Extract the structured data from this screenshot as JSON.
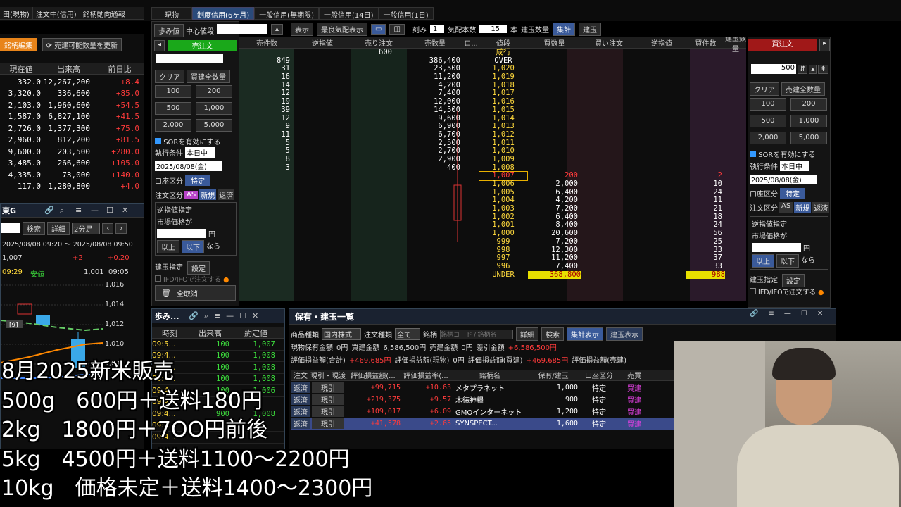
{
  "top_strip": {
    "tabs": [
      "現物",
      "制度信用(6ヶ月)",
      "一般信用(無期限)",
      "一般信用(14日)",
      "一般信用(1日)"
    ],
    "left_tabs": [
      "田(現物)",
      "注文中(信用)",
      "銘柄動向通報"
    ]
  },
  "left_list": {
    "edit_label": "銘柄編集",
    "update_label": "売建可能数量を更新",
    "headers": [
      "現在値",
      "出来高",
      "前日比"
    ],
    "rows": [
      [
        "332.0",
        "12,267,200",
        "+8.4"
      ],
      [
        "3,320.0",
        "336,600",
        "+85.0"
      ],
      [
        "2,103.0",
        "1,960,600",
        "+54.5"
      ],
      [
        "1,587.0",
        "6,827,100",
        "+41.5"
      ],
      [
        "2,726.0",
        "1,377,300",
        "+75.0"
      ],
      [
        "2,960.0",
        "812,200",
        "+81.5"
      ],
      [
        "9,600.0",
        "203,500",
        "+280.0"
      ],
      [
        "3,485.0",
        "266,600",
        "+105.0"
      ],
      [
        "4,335.0",
        "73,000",
        "+140.0"
      ],
      [
        "117.0",
        "1,280,800",
        "+4.0"
      ]
    ]
  },
  "chart_panel": {
    "title": "東G",
    "search_label": "検索",
    "detail_label": "詳細",
    "interval": "2分足",
    "range": "2025/08/08 09:20 ～ 2025/08/08 09:50",
    "price": "1,007",
    "change": "+2",
    "change2": "+0.20",
    "time": "09:29",
    "low_label": "安値",
    "low_value": "1,001",
    "low_time": "09:05",
    "axis": [
      "1,016",
      "1,014",
      "1,012",
      "1,010",
      "1,008"
    ],
    "marker": "[9]"
  },
  "order_left": {
    "ayumi": "歩み値",
    "center_label": "中心値段",
    "display_btn": "表示",
    "best_label": "最良気配表示",
    "sell_btn": "売注文",
    "clear": "クリア",
    "sell_all": "買建全数量",
    "qty": [
      "100",
      "200",
      "500",
      "1,000",
      "2,000",
      "5,000"
    ],
    "sor": "SORを有効にする",
    "exec_label": "執行条件",
    "exec_value": "本日中",
    "date": "2025/08/08(金)",
    "account_label": "口座区分",
    "account_value": "特定",
    "order_type_label": "注文区分",
    "as": "AS",
    "new": "新規",
    "close": "返済",
    "stop_title": "逆指値指定",
    "market_label": "市場価格が",
    "yen": "円",
    "above": "以上",
    "below": "以下",
    "nara": "なら",
    "position_label": "建玉指定",
    "setting": "設定",
    "ifd": "IFD/IFOで注文する",
    "cancel_all": "全取消"
  },
  "board": {
    "kizami_label": "刻み",
    "kizami": "1",
    "ita_label": "気配本数",
    "ita": "15",
    "hon": "本",
    "position_qty": "建玉数量",
    "shukei": "集計",
    "tategyoku": "建玉",
    "headers": [
      "売件数",
      "逆指値",
      "売り注文",
      "売数量",
      "ロ...",
      "値段",
      "買数量",
      "買い注文",
      "逆指値",
      "買件数",
      "建玉数量"
    ],
    "top_order": "600",
    "market_label": "成行",
    "sell_rows": [
      [
        "849",
        "386,400",
        "OVER"
      ],
      [
        "31",
        "23,500",
        "1,020"
      ],
      [
        "16",
        "11,200",
        "1,019"
      ],
      [
        "14",
        "4,200",
        "1,018"
      ],
      [
        "12",
        "7,400",
        "1,017"
      ],
      [
        "19",
        "12,000",
        "1,016"
      ],
      [
        "39",
        "14,500",
        "1,015"
      ],
      [
        "12",
        "9,600",
        "1,014"
      ],
      [
        "9",
        "6,900",
        "1,013"
      ],
      [
        "11",
        "6,700",
        "1,012"
      ],
      [
        "5",
        "2,500",
        "1,011"
      ],
      [
        "5",
        "2,700",
        "1,010"
      ],
      [
        "8",
        "2,900",
        "1,009"
      ],
      [
        "3",
        "400",
        "1,008"
      ]
    ],
    "buy_rows": [
      [
        "1,007",
        "200",
        "2"
      ],
      [
        "1,006",
        "2,000",
        "10"
      ],
      [
        "1,005",
        "6,400",
        "24"
      ],
      [
        "1,004",
        "4,200",
        "11"
      ],
      [
        "1,003",
        "7,200",
        "21"
      ],
      [
        "1,002",
        "6,400",
        "18"
      ],
      [
        "1,001",
        "8,400",
        "24"
      ],
      [
        "1,000",
        "20,600",
        "56"
      ],
      [
        "999",
        "7,200",
        "25"
      ],
      [
        "998",
        "12,300",
        "33"
      ],
      [
        "997",
        "11,200",
        "37"
      ],
      [
        "996",
        "7,400",
        "33"
      ]
    ],
    "under_label": "UNDER",
    "under_qty": "368,800",
    "under_count": "988"
  },
  "order_right": {
    "buy_btn": "買注文",
    "qty_value": "500",
    "clear": "クリア",
    "all": "売建全数量",
    "qty": [
      "100",
      "200",
      "500",
      "1,000",
      "2,000",
      "5,000"
    ],
    "sor": "SORを有効にする",
    "exec_label": "執行条件",
    "exec_value": "本日中",
    "date": "2025/08/08(金)",
    "account_label": "口座区分",
    "account_value": "特定",
    "order_type_label": "注文区分",
    "as": "AS",
    "new": "新規",
    "close": "返済",
    "stop_title": "逆指値指定",
    "market_label": "市場価格が",
    "yen": "円",
    "above": "以上",
    "below": "以下",
    "nara": "なら",
    "position_label": "建玉指定",
    "setting": "設定",
    "ifd": "IFD/IFOで注文する"
  },
  "ticks": {
    "title": "歩み...",
    "headers": [
      "時刻",
      "出来高",
      "約定値"
    ],
    "rows": [
      [
        "09:5...",
        "100",
        "1,007"
      ],
      [
        "09:4...",
        "100",
        "1,008"
      ],
      [
        "09:4...",
        "100",
        "1,008"
      ],
      [
        "09:4...",
        "100",
        "1,008"
      ],
      [
        "09:4...",
        "100",
        "1,006"
      ],
      [
        "09:4...",
        "",
        ""
      ],
      [
        "09:4...",
        "900",
        "1,008"
      ],
      [
        "09:4...",
        "",
        ""
      ],
      [
        "09:4...",
        "",
        ""
      ]
    ]
  },
  "holdings": {
    "title": "保有・建玉一覧",
    "type_label": "商品種類",
    "type_value": "国内株式",
    "order_kind_label": "注文種類",
    "order_kind_value": "全て",
    "symbol_label": "銘柄",
    "symbol_placeholder": "銘柄コード / 銘柄名",
    "detail": "詳細",
    "search": "検索",
    "summary_btn": "集計表示",
    "position_btn": "建玉表示",
    "cash_label": "現物保有金額",
    "cash_value": "0円",
    "buy_amount_label": "買建金額",
    "buy_amount_value": "6,586,500円",
    "sell_amount_label": "売建金額",
    "sell_amount_value": "0円",
    "diff_label": "差引金額",
    "diff_value": "+6,586,500円",
    "pl_total_label": "評価損益額(合計)",
    "pl_total_value": "+469,685円",
    "pl_cash_label": "評価損益額(現物)",
    "pl_cash_value": "0円",
    "pl_buy_label": "評価損益額(買建)",
    "pl_buy_value": "+469,685円",
    "pl_sell_label": "評価損益額(売建)",
    "headers": [
      "注文",
      "現引・現渡",
      "評価損益額(...",
      "評価損益率(...",
      "銘柄名",
      "保有/建玉",
      "口座区分",
      "売買"
    ],
    "rows": [
      [
        "返済",
        "現引",
        "+99,715",
        "+10.63",
        "メタプラネット",
        "1,000",
        "特定",
        "買建"
      ],
      [
        "返済",
        "現引",
        "+219,375",
        "+9.57",
        "木徳神糧",
        "900",
        "特定",
        "買建"
      ],
      [
        "返済",
        "現引",
        "+109,017",
        "+6.09",
        "GMOインターネット",
        "1,200",
        "特定",
        "買建"
      ],
      [
        "返済",
        "現引",
        "+41,578",
        "+2.65",
        "SYNSPECT...",
        "1,600",
        "特定",
        "買建"
      ]
    ]
  },
  "captions": [
    "8月2025新米販売",
    "500g　600円＋送料180円",
    "2kg　1800円＋7OO円前後",
    "5kg　4500円＋送料1100～2200円",
    "10kg　価格未定＋送料1400～2300円"
  ]
}
